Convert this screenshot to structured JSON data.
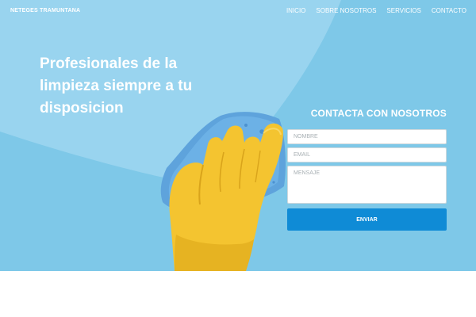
{
  "navbar": {
    "brand": "NETEGES TRAMUNTANA",
    "links": [
      {
        "label": "INICIO"
      },
      {
        "label": "SOBRE NOSOTROS"
      },
      {
        "label": "SERVICIOS"
      },
      {
        "label": "CONTACTO"
      }
    ]
  },
  "hero": {
    "headline": "Profesionales de la limpieza siempre a tu disposicion",
    "illustration": "yellow-glove-sponge",
    "background_color": "#7ec8e8"
  },
  "contact": {
    "title": "CONTACTA CON NOSOTROS",
    "name_placeholder": "NOMBRE",
    "email_placeholder": "EMAIL",
    "message_placeholder": "MENSAJE",
    "submit_label": "ENVIAR",
    "button_color": "#0f8bd6"
  }
}
